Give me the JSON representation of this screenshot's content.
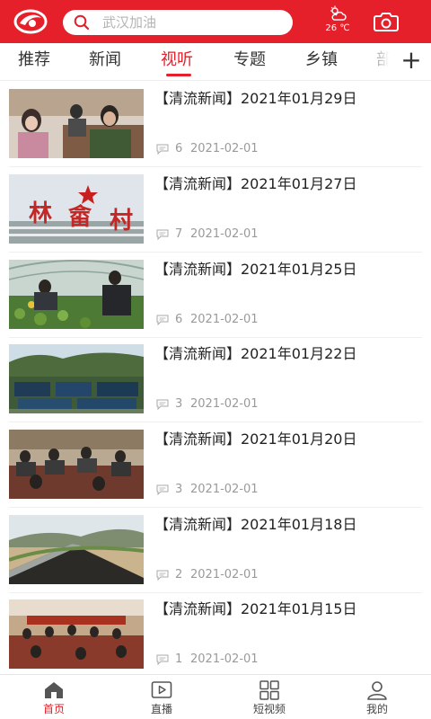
{
  "header": {
    "search_placeholder": "武汉加油",
    "temperature": "26 ℃",
    "brand_color": "#e5202a"
  },
  "tabs": [
    {
      "label": "推荐",
      "active": false
    },
    {
      "label": "新闻",
      "active": false
    },
    {
      "label": "视听",
      "active": true
    },
    {
      "label": "专题",
      "active": false
    },
    {
      "label": "乡镇",
      "active": false
    },
    {
      "label": "部",
      "active": false
    }
  ],
  "tab_add_icon": "plus-icon",
  "news": [
    {
      "title": "【清流新闻】2021年01月29日",
      "comments": "6",
      "date": "2021-02-01",
      "thumb": "officers-meeting"
    },
    {
      "title": "【清流新闻】2021年01月27日",
      "comments": "7",
      "date": "2021-02-01",
      "thumb": "village-sign"
    },
    {
      "title": "【清流新闻】2021年01月25日",
      "comments": "6",
      "date": "2021-02-01",
      "thumb": "greenhouse-farming"
    },
    {
      "title": "【清流新闻】2021年01月22日",
      "comments": "3",
      "date": "2021-02-01",
      "thumb": "fish-ponds"
    },
    {
      "title": "【清流新闻】2021年01月20日",
      "comments": "3",
      "date": "2021-02-01",
      "thumb": "conference-hall"
    },
    {
      "title": "【清流新闻】2021年01月18日",
      "comments": "2",
      "date": "2021-02-01",
      "thumb": "new-road"
    },
    {
      "title": "【清流新闻】2021年01月15日",
      "comments": "1",
      "date": "2021-02-01",
      "thumb": "meeting-room"
    }
  ],
  "bottom_nav": [
    {
      "label": "首页",
      "icon": "home-icon",
      "active": true
    },
    {
      "label": "直播",
      "icon": "live-play-icon",
      "active": false
    },
    {
      "label": "短视频",
      "icon": "grid-icon",
      "active": false
    },
    {
      "label": "我的",
      "icon": "user-icon",
      "active": false
    }
  ]
}
